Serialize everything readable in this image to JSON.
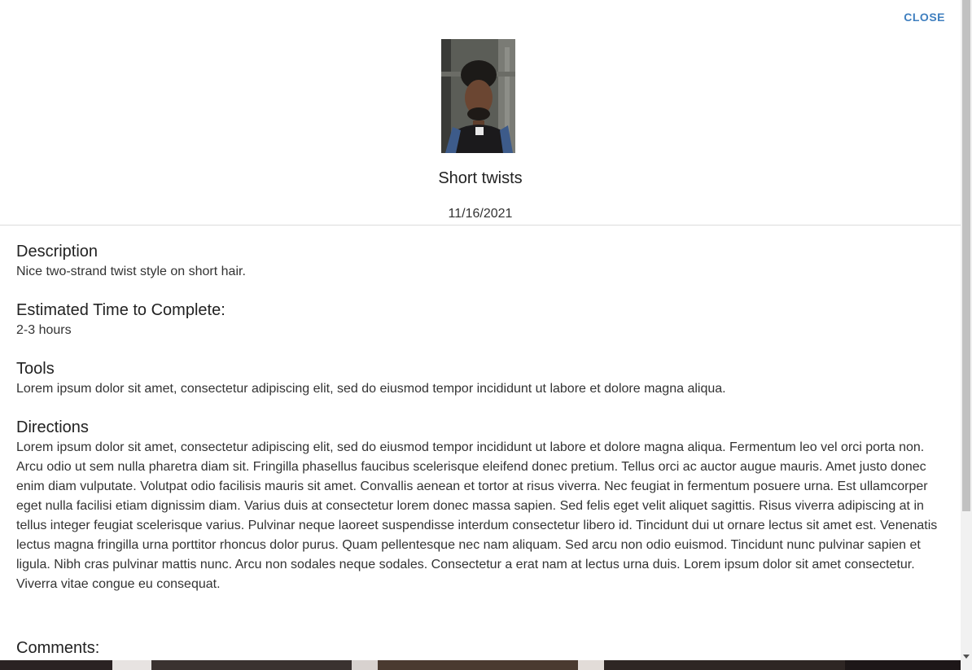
{
  "dialog": {
    "close_label": "CLOSE",
    "title": "Short twists",
    "date": "11/16/2021"
  },
  "sections": {
    "description": {
      "heading": "Description",
      "text": "Nice two-strand twist style on short hair."
    },
    "time": {
      "heading": "Estimated Time to Complete:",
      "text": "2-3 hours"
    },
    "tools": {
      "heading": "Tools",
      "text": "Lorem ipsum dolor sit amet, consectetur adipiscing elit, sed do eiusmod tempor incididunt ut labore et dolore magna aliqua."
    },
    "directions": {
      "heading": "Directions",
      "text": "Lorem ipsum dolor sit amet, consectetur adipiscing elit, sed do eiusmod tempor incididunt ut labore et dolore magna aliqua. Fermentum leo vel orci porta non. Arcu odio ut sem nulla pharetra diam sit. Fringilla phasellus faucibus scelerisque eleifend donec pretium. Tellus orci ac auctor augue mauris. Amet justo donec enim diam vulputate. Volutpat odio facilisis mauris sit amet. Convallis aenean et tortor at risus viverra. Nec feugiat in fermentum posuere urna. Est ullamcorper eget nulla facilisi etiam dignissim diam. Varius duis at consectetur lorem donec massa sapien. Sed felis eget velit aliquet sagittis. Risus viverra adipiscing at in tellus integer feugiat scelerisque varius. Pulvinar neque laoreet suspendisse interdum consectetur libero id. Tincidunt dui ut ornare lectus sit amet est. Venenatis lectus magna fringilla urna porttitor rhoncus dolor purus. Quam pellentesque nec nam aliquam. Sed arcu non odio euismod. Tincidunt nunc pulvinar sapien et ligula. Nibh cras pulvinar mattis nunc. Arcu non sodales neque sodales. Consectetur a erat nam at lectus urna duis. Lorem ipsum dolor sit amet consectetur. Viverra vitae congue eu consequat."
    },
    "comments": {
      "heading": "Comments:"
    }
  },
  "colors": {
    "accent": "#3f7fbf",
    "divider": "#dcdcdc"
  }
}
